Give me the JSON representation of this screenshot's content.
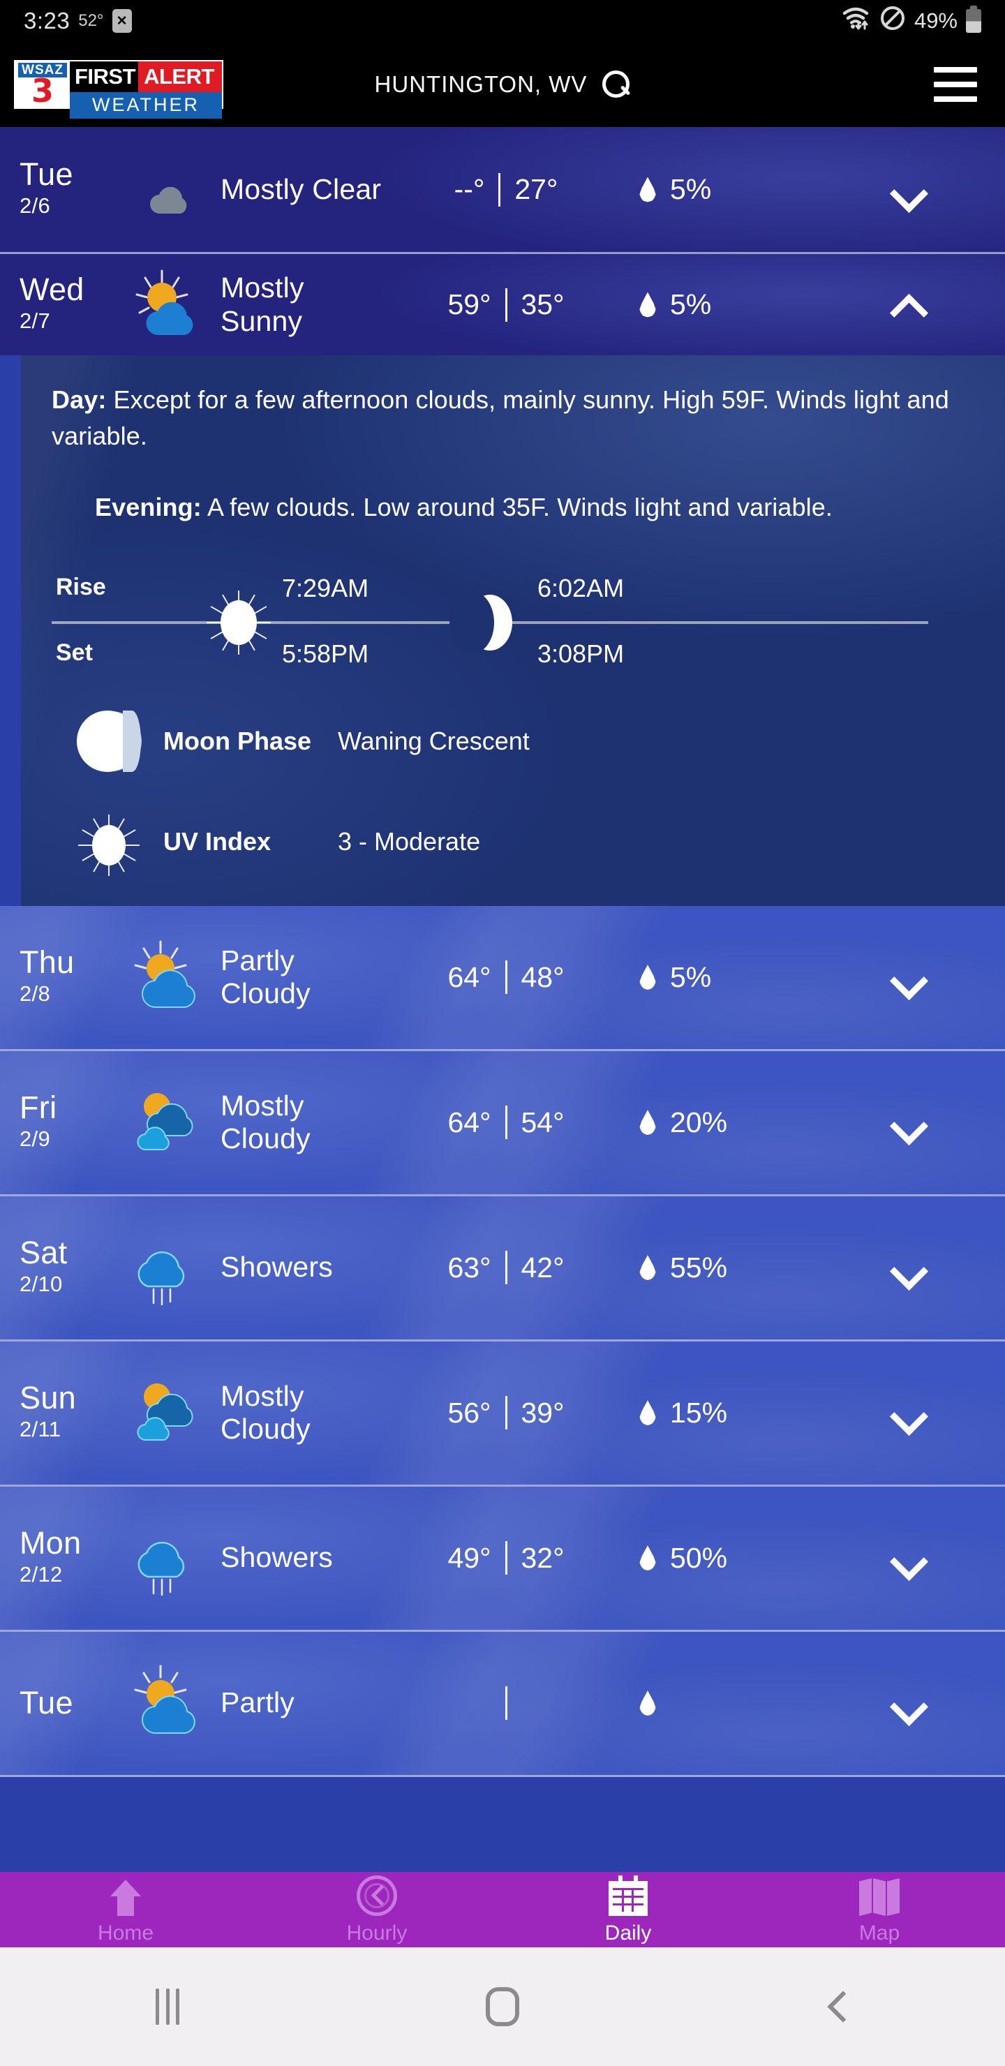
{
  "status_bar": {
    "time": "3:23",
    "temperature": "52°",
    "badge_icon": "x-badge-icon",
    "wifi_icon": "wifi-icon",
    "dnd_icon": "do-not-disturb-icon",
    "battery_percent": "49%",
    "battery_icon": "battery-icon"
  },
  "header": {
    "logo": {
      "station": "WSAZ",
      "channel": "3",
      "first": "FIRST",
      "alert": "ALERT",
      "weather": "WEATHER"
    },
    "city": "HUNTINGTON, WV",
    "search_icon": "search-icon",
    "menu_icon": "hamburger-menu-icon"
  },
  "colors": {
    "row_dark": "#24247e",
    "row_light": "#3d55c0",
    "detail_panel": "#1e3272",
    "tabbar": "#9d27bc",
    "accent_red": "#e01b24",
    "accent_blue": "#1560b0"
  },
  "forecast": [
    {
      "day": "Tue",
      "date": "2/6",
      "icon": "moon-cloud-icon",
      "condition": "Mostly Clear",
      "high": "--°",
      "low": "27°",
      "precip": "5%",
      "chevron": "chevron-down-icon",
      "expanded": false,
      "theme": "dark"
    },
    {
      "day": "Wed",
      "date": "2/7",
      "icon": "sun-cloud-icon",
      "condition": "Mostly Sunny",
      "high": "59°",
      "low": "35°",
      "precip": "5%",
      "chevron": "chevron-up-icon",
      "expanded": true,
      "theme": "dark",
      "detail": {
        "day_label": "Day:",
        "day_text": " Except for a few afternoon clouds, mainly sunny. High 59F. Winds light and variable.",
        "evening_label": "Evening:",
        "evening_text": " A few clouds. Low around 35F. Winds light and variable.",
        "rise_label": "Rise",
        "set_label": "Set",
        "sunrise": "7:29AM",
        "sunset": "5:58PM",
        "moonrise": "6:02AM",
        "moonset": "3:08PM",
        "sun_icon": "sun-icon",
        "moon_icon": "moon-icon",
        "moon_phase_label": "Moon Phase",
        "moon_phase_value": "Waning Crescent",
        "moon_phase_icon": "moon-phase-icon",
        "uv_label": "UV Index",
        "uv_value": "3 - Moderate",
        "uv_icon": "uv-sun-icon"
      }
    },
    {
      "day": "Thu",
      "date": "2/8",
      "icon": "sun-cloud-icon",
      "condition": "Partly Cloudy",
      "high": "64°",
      "low": "48°",
      "precip": "5%",
      "chevron": "chevron-down-icon",
      "expanded": false,
      "theme": "light"
    },
    {
      "day": "Fri",
      "date": "2/9",
      "icon": "sun-clouds-icon",
      "condition": "Mostly Cloudy",
      "high": "64°",
      "low": "54°",
      "precip": "20%",
      "chevron": "chevron-down-icon",
      "expanded": false,
      "theme": "light"
    },
    {
      "day": "Sat",
      "date": "2/10",
      "icon": "rain-cloud-icon",
      "condition": "Showers",
      "high": "63°",
      "low": "42°",
      "precip": "55%",
      "chevron": "chevron-down-icon",
      "expanded": false,
      "theme": "light"
    },
    {
      "day": "Sun",
      "date": "2/11",
      "icon": "sun-clouds-icon",
      "condition": "Mostly Cloudy",
      "high": "56°",
      "low": "39°",
      "precip": "15%",
      "chevron": "chevron-down-icon",
      "expanded": false,
      "theme": "light"
    },
    {
      "day": "Mon",
      "date": "2/12",
      "icon": "rain-cloud-icon",
      "condition": "Showers",
      "high": "49°",
      "low": "32°",
      "precip": "50%",
      "chevron": "chevron-down-icon",
      "expanded": false,
      "theme": "light"
    },
    {
      "day": "Tue",
      "date": "",
      "icon": "sun-horizon-icon",
      "condition": "Partly",
      "high": "",
      "low": "",
      "precip": "",
      "chevron": "chevron-down-icon",
      "expanded": false,
      "theme": "light",
      "clipped": true
    }
  ],
  "tabbar": [
    {
      "label": "Home",
      "icon": "home-icon",
      "active": false
    },
    {
      "label": "Hourly",
      "icon": "clock-icon",
      "active": false
    },
    {
      "label": "Daily",
      "icon": "calendar-icon",
      "active": true
    },
    {
      "label": "Map",
      "icon": "map-icon",
      "active": false
    }
  ],
  "nav_bar": {
    "recents_icon": "recents-icon",
    "home_icon": "home-pill-icon",
    "back_icon": "back-icon"
  }
}
